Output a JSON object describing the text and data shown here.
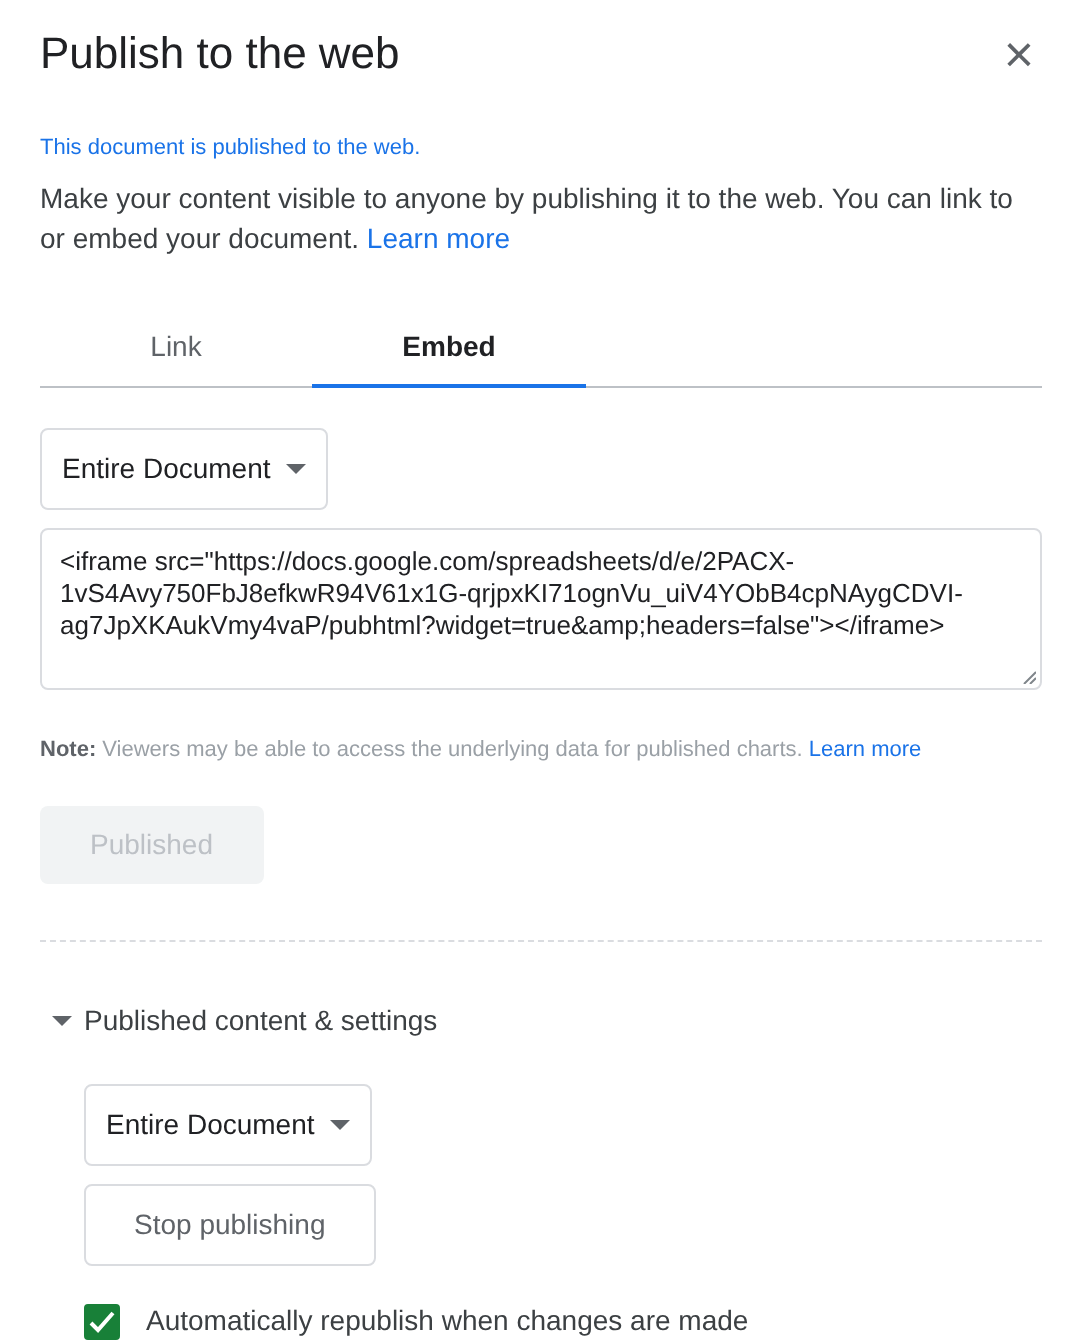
{
  "dialog": {
    "title": "Publish to the web",
    "close": "×"
  },
  "status": "This document is published to the web.",
  "description": {
    "text": "Make your content visible to anyone by publishing it to the web. You can link to or embed your document.",
    "link": "Learn more"
  },
  "tabs": [
    {
      "label": "Link",
      "selected": false
    },
    {
      "label": "Embed",
      "selected": true
    }
  ],
  "scope_dropdown": {
    "value": "Entire Document"
  },
  "embed_code": {
    "value": "<iframe src=\"https://docs.google.com/spreadsheets/d/e/2PACX-1vS4Avy750FbJ8efkwR94V61x1G-qrjpxKI71ognVu_uiV4YObB4cpNAygCDVI-ag7JpXKAukVmy4vaP/pubhtml?widget=true&amp;headers=false\"></iframe>"
  },
  "note": {
    "text": "**Note:** Viewers may be able to access the underlying data for published charts.",
    "link": "Learn more"
  },
  "publish_button": {
    "label": "Published",
    "disabled": true
  },
  "settings": {
    "label": "Published content & settings",
    "expanded": true,
    "dropdown": {
      "value": "Entire Document"
    },
    "stop_button": {
      "label": "Stop publishing"
    },
    "auto_republish": {
      "label": "Automatically republish when changes are made",
      "checked": true
    }
  }
}
